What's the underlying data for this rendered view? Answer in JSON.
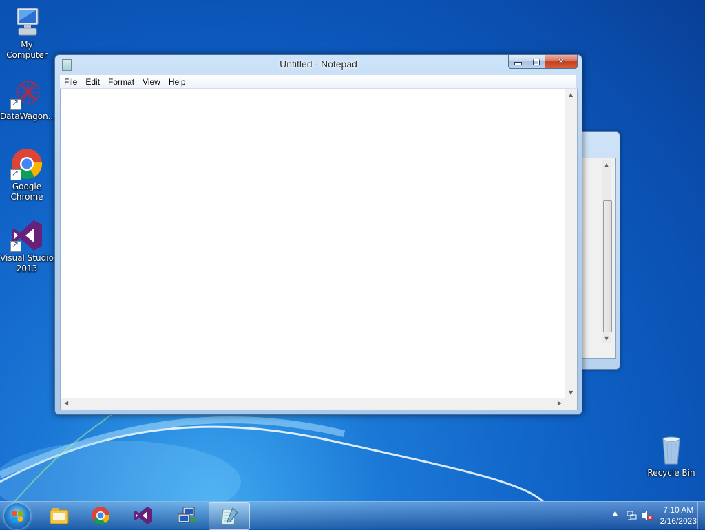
{
  "desktop": {
    "icons": [
      {
        "label": "My Computer"
      },
      {
        "label": "DataWagon..."
      },
      {
        "label": "Google Chrome"
      },
      {
        "label": "Visual Studio 2013"
      },
      {
        "label": "Recycle Bin"
      }
    ]
  },
  "notepad": {
    "title": "Untitled - Notepad",
    "menu": [
      {
        "label": "File"
      },
      {
        "label": "Edit"
      },
      {
        "label": "Format"
      },
      {
        "label": "View"
      },
      {
        "label": "Help"
      }
    ],
    "content": "",
    "controls": {
      "minimize": "minimize-icon",
      "maximize": "maximize-icon",
      "close": "close-icon"
    }
  },
  "taskbar": {
    "pinned": [
      {
        "name": "windows-explorer-icon"
      },
      {
        "name": "chrome-icon"
      },
      {
        "name": "visual-studio-icon"
      },
      {
        "name": "remote-desktop-icon"
      },
      {
        "name": "notepad-icon"
      }
    ],
    "clock": {
      "time": "7:10 AM",
      "date": "2/16/2023"
    }
  },
  "colors": {
    "accent": "#1b78d6",
    "close_button": "#c4411f"
  }
}
